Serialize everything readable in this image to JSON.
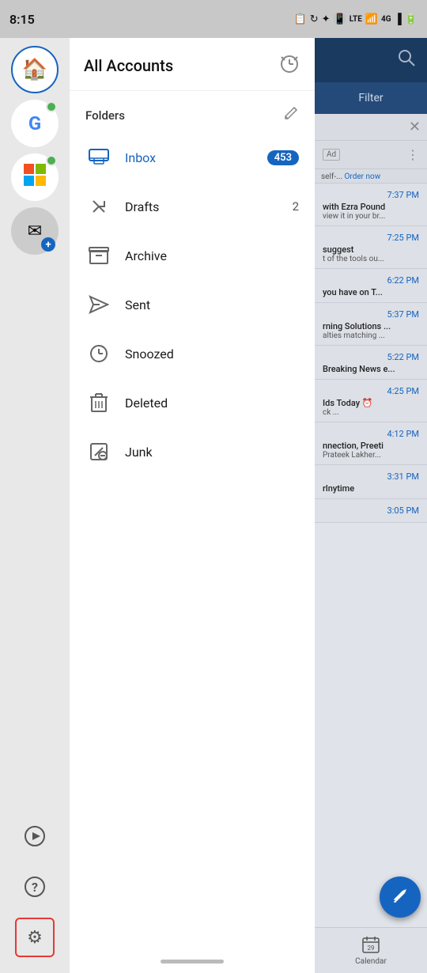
{
  "statusBar": {
    "time": "8:15",
    "icons": [
      "clipboard",
      "refresh",
      "bluetooth",
      "vibrate",
      "signal_lte",
      "wifi",
      "signal_4g",
      "signal_bars",
      "battery"
    ]
  },
  "leftSidebar": {
    "appIcons": [
      {
        "id": "home",
        "label": "Home",
        "type": "home",
        "badgeColor": null
      },
      {
        "id": "google",
        "label": "Google",
        "type": "G",
        "badgeColor": "#4caf50"
      },
      {
        "id": "office",
        "label": "Office",
        "type": "O365",
        "badgeColor": "#4caf50"
      },
      {
        "id": "add-account",
        "label": "Add Account",
        "type": "mail-add",
        "badgeColor": null
      }
    ],
    "bottomIcons": [
      {
        "id": "play",
        "label": "Play",
        "icon": "▶"
      },
      {
        "id": "help",
        "label": "Help",
        "icon": "?"
      },
      {
        "id": "settings",
        "label": "Settings",
        "icon": "⚙",
        "active": true
      }
    ]
  },
  "drawer": {
    "title": "All Accounts",
    "headerIcon": "alarm",
    "foldersLabel": "Folders",
    "folders": [
      {
        "id": "inbox",
        "name": "Inbox",
        "badge": "453",
        "count": null,
        "active": true
      },
      {
        "id": "drafts",
        "name": "Drafts",
        "badge": null,
        "count": "2"
      },
      {
        "id": "archive",
        "name": "Archive",
        "badge": null,
        "count": null
      },
      {
        "id": "sent",
        "name": "Sent",
        "badge": null,
        "count": null
      },
      {
        "id": "snoozed",
        "name": "Snoozed",
        "badge": null,
        "count": null
      },
      {
        "id": "deleted",
        "name": "Deleted",
        "badge": null,
        "count": null
      },
      {
        "id": "junk",
        "name": "Junk",
        "badge": null,
        "count": null
      }
    ]
  },
  "mainContent": {
    "filterLabel": "Filter",
    "emails": [
      {
        "time": "7:37 PM",
        "sender": "with Ezra Pound",
        "preview": "view it in your br..."
      },
      {
        "time": "7:25 PM",
        "sender": "suggest",
        "preview": "t of the tools ou..."
      },
      {
        "time": "6:22 PM",
        "sender": "you have on T...",
        "preview": ""
      },
      {
        "time": "5:37 PM",
        "sender": "rning Solutions ...",
        "preview": "alties matching ..."
      },
      {
        "time": "5:22 PM",
        "sender": "Breaking News e...",
        "preview": ""
      },
      {
        "time": "4:25 PM",
        "sender": "Ids Today ⏰",
        "preview": "ck  ..."
      },
      {
        "time": "4:12 PM",
        "sender": "nnection, Preeti",
        "preview": "Prateek Lakher..."
      },
      {
        "time": "3:31 PM",
        "sender": "rlnytime",
        "preview": ""
      },
      {
        "time": "3:05 PM",
        "sender": "",
        "preview": ""
      }
    ],
    "calendarLabel": "Calendar",
    "fabLabel": "Compose"
  }
}
